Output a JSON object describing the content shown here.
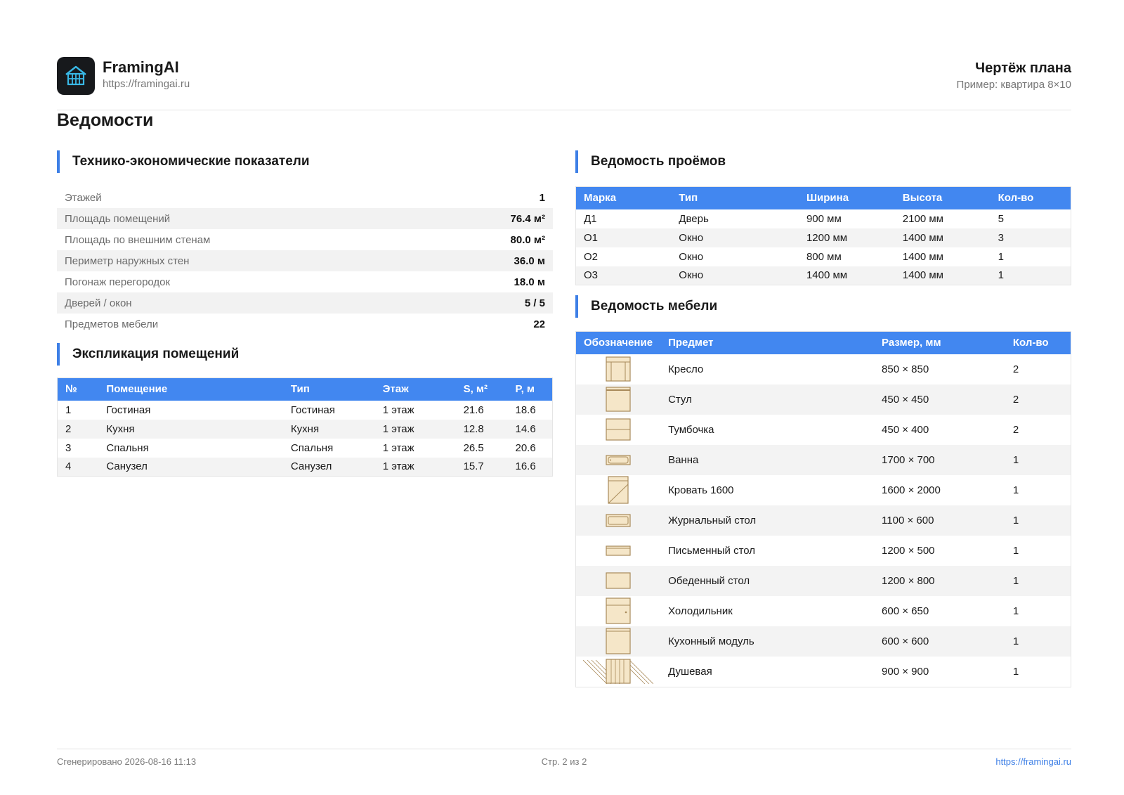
{
  "brand": {
    "name": "FramingAI",
    "url": "https://framingai.ru"
  },
  "document": {
    "title": "Чертёж плана",
    "subtitle": "Пример: квартира 8×10"
  },
  "page_title": "Ведомости",
  "kpi": {
    "title": "Технико-экономические показатели",
    "rows": [
      {
        "label": "Этажей",
        "value": "1"
      },
      {
        "label": "Площадь помещений",
        "value": "76.4 м²"
      },
      {
        "label": "Площадь по внешним стенам",
        "value": "80.0 м²"
      },
      {
        "label": "Периметр наружных стен",
        "value": "36.0 м"
      },
      {
        "label": "Погонаж перегородок",
        "value": "18.0 м"
      },
      {
        "label": "Дверей / окон",
        "value": "5 / 5"
      },
      {
        "label": "Предметов мебели",
        "value": "22"
      }
    ]
  },
  "rooms": {
    "title": "Экспликация помещений",
    "headers": [
      "№",
      "Помещение",
      "Тип",
      "Этаж",
      "S, м²",
      "P, м"
    ],
    "rows": [
      [
        "1",
        "Гостиная",
        "Гостиная",
        "1 этаж",
        "21.6",
        "18.6"
      ],
      [
        "2",
        "Кухня",
        "Кухня",
        "1 этаж",
        "12.8",
        "14.6"
      ],
      [
        "3",
        "Спальня",
        "Спальня",
        "1 этаж",
        "26.5",
        "20.6"
      ],
      [
        "4",
        "Санузел",
        "Санузел",
        "1 этаж",
        "15.7",
        "16.6"
      ]
    ]
  },
  "openings": {
    "title": "Ведомость проёмов",
    "headers": [
      "Марка",
      "Тип",
      "Ширина",
      "Высота",
      "Кол-во"
    ],
    "rows": [
      [
        "Д1",
        "Дверь",
        "900 мм",
        "2100 мм",
        "5"
      ],
      [
        "О1",
        "Окно",
        "1200 мм",
        "1400 мм",
        "3"
      ],
      [
        "О2",
        "Окно",
        "800 мм",
        "1400 мм",
        "1"
      ],
      [
        "О3",
        "Окно",
        "1400 мм",
        "1400 мм",
        "1"
      ]
    ]
  },
  "furniture": {
    "title": "Ведомость мебели",
    "headers": [
      "Обозначение",
      "Предмет",
      "Размер, мм",
      "Кол-во"
    ],
    "rows": [
      {
        "icon": "armchair-icon",
        "name": "Кресло",
        "size": "850 × 850",
        "qty": "2"
      },
      {
        "icon": "chair-icon",
        "name": "Стул",
        "size": "450 × 450",
        "qty": "2"
      },
      {
        "icon": "nightstand-icon",
        "name": "Тумбочка",
        "size": "450 × 400",
        "qty": "2"
      },
      {
        "icon": "bathtub-icon",
        "name": "Ванна",
        "size": "1700 × 700",
        "qty": "1"
      },
      {
        "icon": "bed-icon",
        "name": "Кровать 1600",
        "size": "1600 × 2000",
        "qty": "1"
      },
      {
        "icon": "coffee-table-icon",
        "name": "Журнальный стол",
        "size": "1100 × 600",
        "qty": "1"
      },
      {
        "icon": "desk-icon",
        "name": "Письменный стол",
        "size": "1200 × 500",
        "qty": "1"
      },
      {
        "icon": "dining-table-icon",
        "name": "Обеденный стол",
        "size": "1200 × 800",
        "qty": "1"
      },
      {
        "icon": "fridge-icon",
        "name": "Холодильник",
        "size": "600 × 650",
        "qty": "1"
      },
      {
        "icon": "kitchen-module-icon",
        "name": "Кухонный модуль",
        "size": "600 × 600",
        "qty": "1"
      },
      {
        "icon": "shower-icon",
        "name": "Душевая",
        "size": "900 × 900",
        "qty": "1"
      }
    ]
  },
  "footer": {
    "generated": "Сгенерировано 2026-08-16 11:13",
    "page": "Стр. 2 из 2",
    "url": "https://framingai.ru"
  },
  "colors": {
    "accent": "#4287f0",
    "furniture_fill": "#f5e6c8",
    "furniture_stroke": "#a88a5a"
  }
}
